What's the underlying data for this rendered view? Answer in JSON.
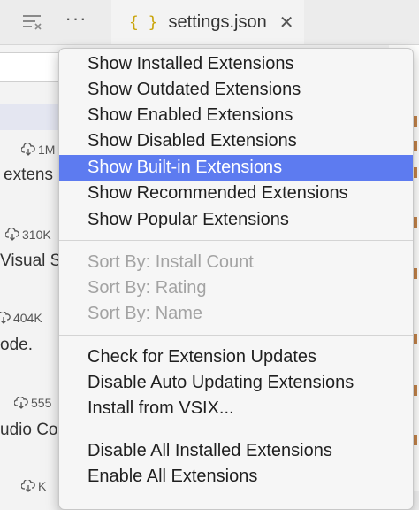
{
  "tab": {
    "icon": "curly-braces-icon",
    "icon_glyph": "{ }",
    "label": "settings.json",
    "close_glyph": "✕"
  },
  "toolbar": {
    "more_glyph": "···"
  },
  "sidebar": {
    "items": [
      {
        "count": "1M",
        "desc": "extens"
      },
      {
        "count": "310K",
        "desc": "Visual S"
      },
      {
        "count": "404K",
        "desc": "ode."
      },
      {
        "count": "555",
        "desc": "udio Co"
      },
      {
        "count": "K",
        "desc": ""
      }
    ]
  },
  "menu": {
    "highlight_color": "#5d7bf0",
    "groups": [
      [
        {
          "label": "Show Installed Extensions",
          "enabled": true
        },
        {
          "label": "Show Outdated Extensions",
          "enabled": true
        },
        {
          "label": "Show Enabled Extensions",
          "enabled": true
        },
        {
          "label": "Show Disabled Extensions",
          "enabled": true
        },
        {
          "label": "Show Built-in Extensions",
          "enabled": true,
          "highlighted": true
        },
        {
          "label": "Show Recommended Extensions",
          "enabled": true
        },
        {
          "label": "Show Popular Extensions",
          "enabled": true
        }
      ],
      [
        {
          "label": "Sort By: Install Count",
          "enabled": false
        },
        {
          "label": "Sort By: Rating",
          "enabled": false
        },
        {
          "label": "Sort By: Name",
          "enabled": false
        }
      ],
      [
        {
          "label": "Check for Extension Updates",
          "enabled": true
        },
        {
          "label": "Disable Auto Updating Extensions",
          "enabled": true
        },
        {
          "label": "Install from VSIX...",
          "enabled": true
        }
      ],
      [
        {
          "label": "Disable All Installed Extensions",
          "enabled": true
        },
        {
          "label": "Enable All Extensions",
          "enabled": true
        }
      ]
    ]
  }
}
